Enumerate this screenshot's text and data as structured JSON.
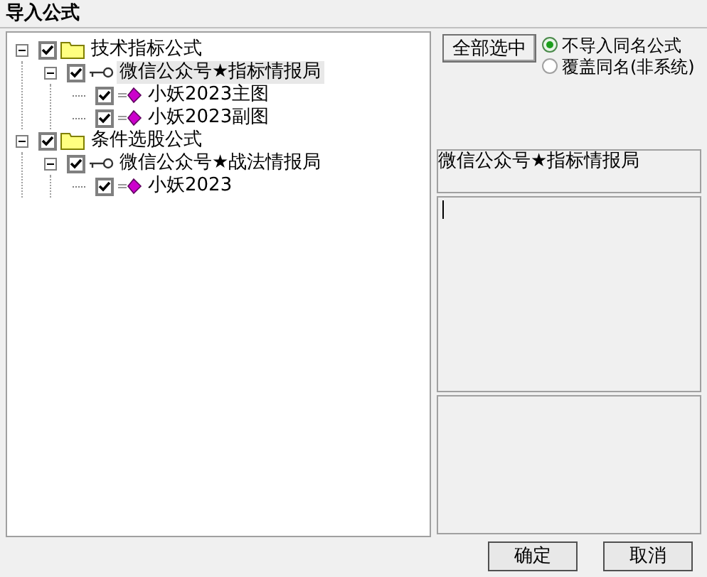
{
  "window": {
    "title": "导入公式"
  },
  "tree": [
    {
      "label": "技术指标公式",
      "kind": "folder",
      "checked": true,
      "expanded": true,
      "selected": false,
      "children": [
        {
          "label": "微信公众号★指标情报局",
          "kind": "group",
          "checked": true,
          "expanded": true,
          "selected": true,
          "children": [
            {
              "label": "小妖2023主图",
              "kind": "formula",
              "checked": true,
              "selected": false
            },
            {
              "label": "小妖2023副图",
              "kind": "formula",
              "checked": true,
              "selected": false
            }
          ]
        }
      ]
    },
    {
      "label": "条件选股公式",
      "kind": "folder",
      "checked": true,
      "expanded": true,
      "selected": false,
      "children": [
        {
          "label": "微信公众号★战法情报局",
          "kind": "group",
          "checked": true,
          "expanded": true,
          "selected": false,
          "children": [
            {
              "label": "小妖2023",
              "kind": "formula",
              "checked": true,
              "selected": false
            }
          ]
        }
      ]
    }
  ],
  "select_all_button": "全部选中",
  "options": [
    {
      "label": "不导入同名公式",
      "selected": true
    },
    {
      "label": "覆盖同名(非系统)",
      "selected": false
    }
  ],
  "info_label": "微信公众号★指标情报局",
  "buttons": [
    "确定",
    "取消"
  ]
}
